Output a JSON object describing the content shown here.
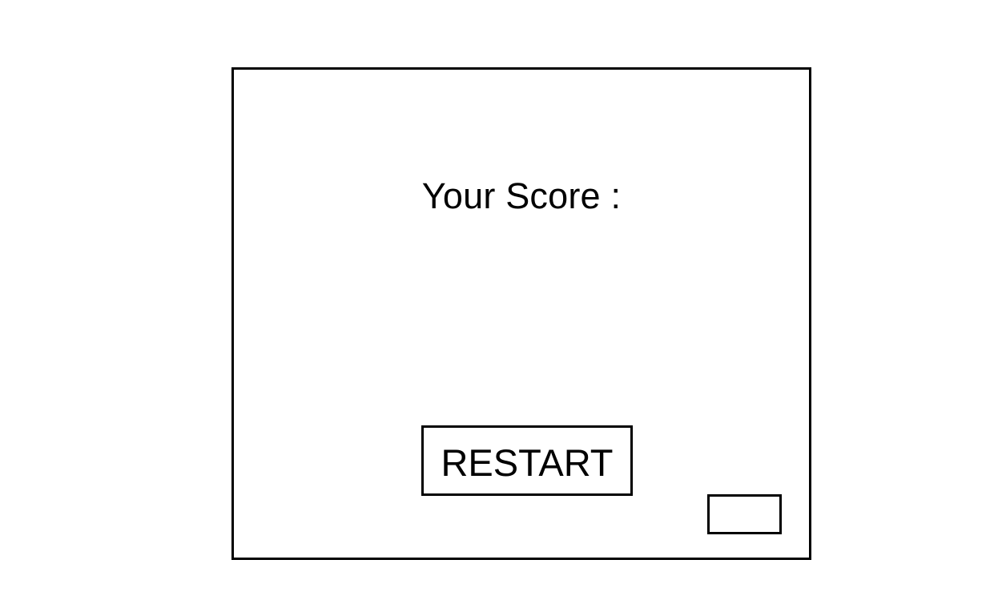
{
  "game_over": {
    "score_label": "Your Score :",
    "restart_label": "RESTART",
    "corner_button_label": ""
  },
  "colors": {
    "background": "#ffffff",
    "border": "#000000",
    "text": "#000000"
  }
}
